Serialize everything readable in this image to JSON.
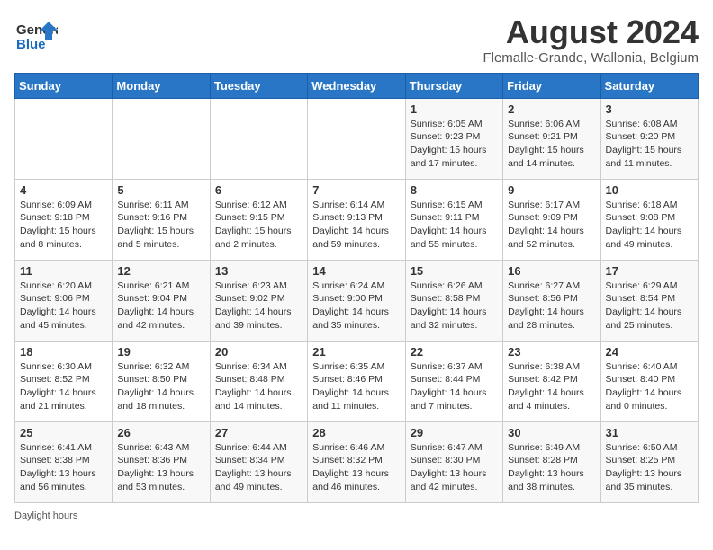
{
  "header": {
    "logo_general": "General",
    "logo_blue": "Blue",
    "title": "August 2024",
    "subtitle": "Flemalle-Grande, Wallonia, Belgium"
  },
  "weekdays": [
    "Sunday",
    "Monday",
    "Tuesday",
    "Wednesday",
    "Thursday",
    "Friday",
    "Saturday"
  ],
  "weeks": [
    [
      {
        "day": "",
        "detail": ""
      },
      {
        "day": "",
        "detail": ""
      },
      {
        "day": "",
        "detail": ""
      },
      {
        "day": "",
        "detail": ""
      },
      {
        "day": "1",
        "detail": "Sunrise: 6:05 AM\nSunset: 9:23 PM\nDaylight: 15 hours\nand 17 minutes."
      },
      {
        "day": "2",
        "detail": "Sunrise: 6:06 AM\nSunset: 9:21 PM\nDaylight: 15 hours\nand 14 minutes."
      },
      {
        "day": "3",
        "detail": "Sunrise: 6:08 AM\nSunset: 9:20 PM\nDaylight: 15 hours\nand 11 minutes."
      }
    ],
    [
      {
        "day": "4",
        "detail": "Sunrise: 6:09 AM\nSunset: 9:18 PM\nDaylight: 15 hours\nand 8 minutes."
      },
      {
        "day": "5",
        "detail": "Sunrise: 6:11 AM\nSunset: 9:16 PM\nDaylight: 15 hours\nand 5 minutes."
      },
      {
        "day": "6",
        "detail": "Sunrise: 6:12 AM\nSunset: 9:15 PM\nDaylight: 15 hours\nand 2 minutes."
      },
      {
        "day": "7",
        "detail": "Sunrise: 6:14 AM\nSunset: 9:13 PM\nDaylight: 14 hours\nand 59 minutes."
      },
      {
        "day": "8",
        "detail": "Sunrise: 6:15 AM\nSunset: 9:11 PM\nDaylight: 14 hours\nand 55 minutes."
      },
      {
        "day": "9",
        "detail": "Sunrise: 6:17 AM\nSunset: 9:09 PM\nDaylight: 14 hours\nand 52 minutes."
      },
      {
        "day": "10",
        "detail": "Sunrise: 6:18 AM\nSunset: 9:08 PM\nDaylight: 14 hours\nand 49 minutes."
      }
    ],
    [
      {
        "day": "11",
        "detail": "Sunrise: 6:20 AM\nSunset: 9:06 PM\nDaylight: 14 hours\nand 45 minutes."
      },
      {
        "day": "12",
        "detail": "Sunrise: 6:21 AM\nSunset: 9:04 PM\nDaylight: 14 hours\nand 42 minutes."
      },
      {
        "day": "13",
        "detail": "Sunrise: 6:23 AM\nSunset: 9:02 PM\nDaylight: 14 hours\nand 39 minutes."
      },
      {
        "day": "14",
        "detail": "Sunrise: 6:24 AM\nSunset: 9:00 PM\nDaylight: 14 hours\nand 35 minutes."
      },
      {
        "day": "15",
        "detail": "Sunrise: 6:26 AM\nSunset: 8:58 PM\nDaylight: 14 hours\nand 32 minutes."
      },
      {
        "day": "16",
        "detail": "Sunrise: 6:27 AM\nSunset: 8:56 PM\nDaylight: 14 hours\nand 28 minutes."
      },
      {
        "day": "17",
        "detail": "Sunrise: 6:29 AM\nSunset: 8:54 PM\nDaylight: 14 hours\nand 25 minutes."
      }
    ],
    [
      {
        "day": "18",
        "detail": "Sunrise: 6:30 AM\nSunset: 8:52 PM\nDaylight: 14 hours\nand 21 minutes."
      },
      {
        "day": "19",
        "detail": "Sunrise: 6:32 AM\nSunset: 8:50 PM\nDaylight: 14 hours\nand 18 minutes."
      },
      {
        "day": "20",
        "detail": "Sunrise: 6:34 AM\nSunset: 8:48 PM\nDaylight: 14 hours\nand 14 minutes."
      },
      {
        "day": "21",
        "detail": "Sunrise: 6:35 AM\nSunset: 8:46 PM\nDaylight: 14 hours\nand 11 minutes."
      },
      {
        "day": "22",
        "detail": "Sunrise: 6:37 AM\nSunset: 8:44 PM\nDaylight: 14 hours\nand 7 minutes."
      },
      {
        "day": "23",
        "detail": "Sunrise: 6:38 AM\nSunset: 8:42 PM\nDaylight: 14 hours\nand 4 minutes."
      },
      {
        "day": "24",
        "detail": "Sunrise: 6:40 AM\nSunset: 8:40 PM\nDaylight: 14 hours\nand 0 minutes."
      }
    ],
    [
      {
        "day": "25",
        "detail": "Sunrise: 6:41 AM\nSunset: 8:38 PM\nDaylight: 13 hours\nand 56 minutes."
      },
      {
        "day": "26",
        "detail": "Sunrise: 6:43 AM\nSunset: 8:36 PM\nDaylight: 13 hours\nand 53 minutes."
      },
      {
        "day": "27",
        "detail": "Sunrise: 6:44 AM\nSunset: 8:34 PM\nDaylight: 13 hours\nand 49 minutes."
      },
      {
        "day": "28",
        "detail": "Sunrise: 6:46 AM\nSunset: 8:32 PM\nDaylight: 13 hours\nand 46 minutes."
      },
      {
        "day": "29",
        "detail": "Sunrise: 6:47 AM\nSunset: 8:30 PM\nDaylight: 13 hours\nand 42 minutes."
      },
      {
        "day": "30",
        "detail": "Sunrise: 6:49 AM\nSunset: 8:28 PM\nDaylight: 13 hours\nand 38 minutes."
      },
      {
        "day": "31",
        "detail": "Sunrise: 6:50 AM\nSunset: 8:25 PM\nDaylight: 13 hours\nand 35 minutes."
      }
    ]
  ],
  "footer": "Daylight hours"
}
